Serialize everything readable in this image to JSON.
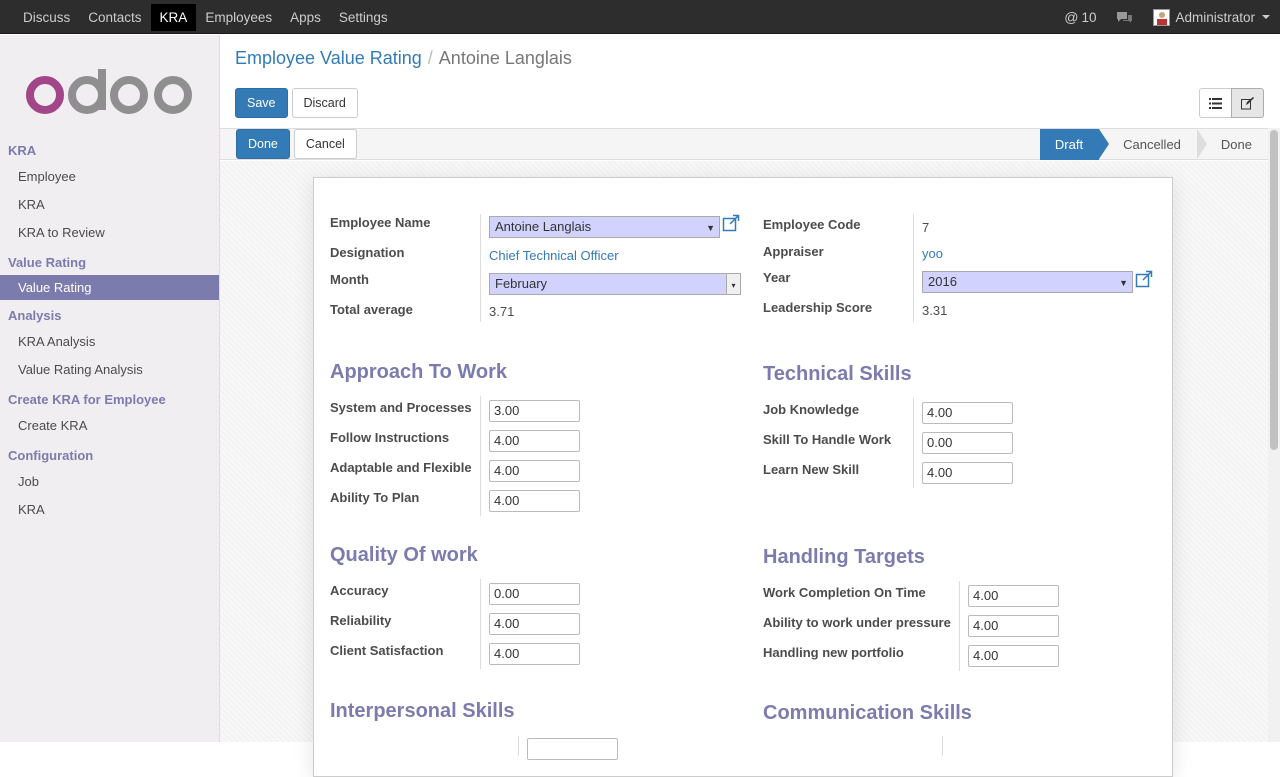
{
  "topbar": {
    "menu": [
      "Discuss",
      "Contacts",
      "KRA",
      "Employees",
      "Apps",
      "Settings"
    ],
    "active": "KRA",
    "messages_count": "10",
    "user": "Administrator"
  },
  "sidebar": {
    "logo": "odoo",
    "sections": [
      {
        "title": "KRA",
        "items": [
          "Employee",
          "KRA",
          "KRA to Review"
        ]
      },
      {
        "title": "Value Rating",
        "items": [
          "Value Rating"
        ]
      },
      {
        "title": "Analysis",
        "items": [
          "KRA Analysis",
          "Value Rating Analysis"
        ]
      },
      {
        "title": "Create KRA for Employee",
        "items": [
          "Create KRA"
        ]
      },
      {
        "title": "Configuration",
        "items": [
          "Job",
          "KRA"
        ]
      }
    ],
    "active_item": "Value Rating"
  },
  "breadcrumb": {
    "parent": "Employee Value Rating",
    "separator": "/",
    "current": "Antoine Langlais"
  },
  "buttons": {
    "save": "Save",
    "discard": "Discard",
    "done": "Done",
    "cancel": "Cancel"
  },
  "stages": [
    "Draft",
    "Cancelled",
    "Done"
  ],
  "active_stage": "Draft",
  "form": {
    "employee_name_label": "Employee Name",
    "employee_name": "Antoine Langlais",
    "designation_label": "Designation",
    "designation": "Chief Technical Officer",
    "month_label": "Month",
    "month": "February",
    "total_average_label": "Total average",
    "total_average": "3.71",
    "employee_code_label": "Employee Code",
    "employee_code": "7",
    "appraiser_label": "Appraiser",
    "appraiser": "yoo",
    "year_label": "Year",
    "year": "2016",
    "leadership_score_label": "Leadership Score",
    "leadership_score": "3.31"
  },
  "sections": {
    "approach": {
      "title": "Approach To Work",
      "rows": [
        {
          "label": "System and Processes",
          "value": "3.00"
        },
        {
          "label": "Follow Instructions",
          "value": "4.00"
        },
        {
          "label": "Adaptable and Flexible",
          "value": "4.00"
        },
        {
          "label": "Ability To Plan",
          "value": "4.00"
        }
      ]
    },
    "technical": {
      "title": "Technical Skills",
      "rows": [
        {
          "label": "Job Knowledge",
          "value": "4.00"
        },
        {
          "label": "Skill To Handle Work",
          "value": "0.00"
        },
        {
          "label": "Learn New Skill",
          "value": "4.00"
        }
      ]
    },
    "quality": {
      "title": "Quality Of work",
      "rows": [
        {
          "label": "Accuracy",
          "value": "0.00"
        },
        {
          "label": "Reliability",
          "value": "4.00"
        },
        {
          "label": "Client Satisfaction",
          "value": "4.00"
        }
      ]
    },
    "targets": {
      "title": "Handling Targets",
      "rows": [
        {
          "label": "Work Completion On Time",
          "value": "4.00"
        },
        {
          "label": "Ability to work under pressure",
          "value": "4.00"
        },
        {
          "label": "Handling new portfolio",
          "value": "4.00"
        }
      ]
    },
    "interpersonal": {
      "title": "Interpersonal Skills"
    },
    "communication": {
      "title": "Communication Skills"
    }
  }
}
